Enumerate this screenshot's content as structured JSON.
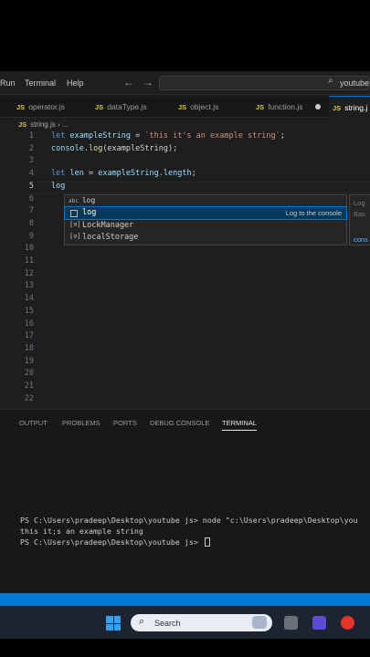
{
  "titlebar": {
    "menus": [
      "Run",
      "Terminal",
      "Help"
    ],
    "nav_back": "←",
    "nav_forward": "→",
    "command_center": "youtube"
  },
  "tabs": [
    {
      "label": "operator.js",
      "active": false
    },
    {
      "label": "dataType.js",
      "active": false
    },
    {
      "label": "object.js",
      "active": false
    },
    {
      "label": "function.js",
      "active": false,
      "dirty": true
    },
    {
      "label": "string.j",
      "active": true
    }
  ],
  "breadcrumb": {
    "file": "string.js",
    "sep": "› ..."
  },
  "editor": {
    "line_numbers": [
      "1",
      "2",
      "3",
      "4",
      "5",
      "6",
      "7",
      "8",
      "9",
      "10",
      "11",
      "12",
      "13",
      "14",
      "15",
      "16",
      "17",
      "18",
      "19",
      "20",
      "21",
      "22"
    ],
    "line1": {
      "kw": "let",
      "var": "exampleString",
      "op": " = ",
      "str": "`this it's an example string`",
      "end": ";"
    },
    "line2": {
      "obj": "console",
      "dot": ".",
      "fn": "log",
      "args": "(exampleString);"
    },
    "line4": {
      "kw": "let",
      "var": "len",
      "op": " = ",
      "obj": "exampleString",
      "prop": ".length",
      "end": ";"
    },
    "line5": {
      "text": "log"
    }
  },
  "suggest": {
    "header_tag": "abc",
    "header_label": "log",
    "items": [
      {
        "label": "log",
        "detail": "Log to the console",
        "selected": true
      },
      {
        "label": "LockManager",
        "detail": "",
        "selected": false
      },
      {
        "label": "localStorage",
        "detail": "",
        "selected": false
      }
    ],
    "doc_lines": [
      "Log",
      "Bas",
      "cons"
    ]
  },
  "panel": {
    "tabs": [
      "OUTPUT",
      "PROBLEMS",
      "PORTS",
      "DEBUG CONSOLE",
      "TERMINAL"
    ],
    "active_tab": "TERMINAL",
    "terminal_lines": [
      "PS C:\\Users\\pradeep\\Desktop\\youtube js> node \"c:\\Users\\pradeep\\Desktop\\you",
      "this it;s an example string",
      "PS C:\\Users\\pradeep\\Desktop\\youtube js> "
    ]
  },
  "taskbar": {
    "search_label": "Search"
  },
  "colors": {
    "accent": "#0078d4",
    "editor_bg": "#1e1e1e",
    "keyword": "#569cd6",
    "string": "#ce9178",
    "function": "#dcdcaa",
    "variable": "#9cdcfe"
  }
}
